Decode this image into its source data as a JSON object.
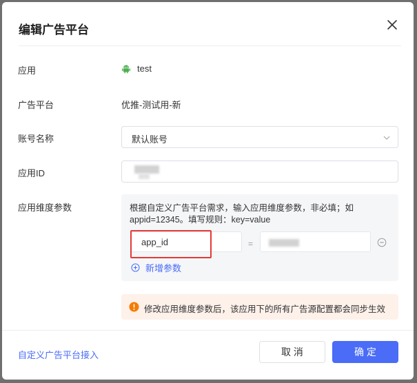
{
  "dialog": {
    "title": "编辑广告平台",
    "close_icon": "close-icon"
  },
  "form": {
    "app": {
      "label": "应用",
      "value": "test",
      "icon": "android-icon",
      "icon_color": "#4caf50"
    },
    "platform": {
      "label": "广告平台",
      "value": "优推-测试用-新"
    },
    "account": {
      "label": "账号名称",
      "selected": "默认账号",
      "icon": "chevron-down-icon"
    },
    "app_id": {
      "label": "应用ID"
    },
    "dimension": {
      "label": "应用维度参数",
      "hint": "根据自定义广告平台需求，输入应用维度参数，非必填；如appid=12345。填写规则：key=value",
      "key_value": "app_id",
      "eq": "=",
      "add_label": "新增参数"
    }
  },
  "warning": {
    "text": "修改应用维度参数后，该应用下的所有广告源配置都会同步生效",
    "color": "#f57c00"
  },
  "footer": {
    "custom_link": "自定义广告平台接入",
    "cancel": "取 消",
    "confirm": "确 定"
  },
  "colors": {
    "accent": "#4a6cf7",
    "highlight_frame": "#e53935"
  }
}
